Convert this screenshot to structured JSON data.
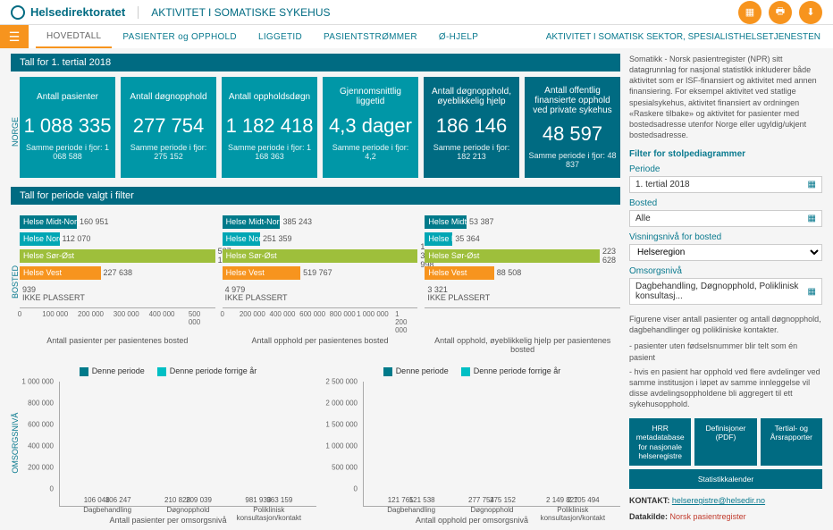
{
  "header": {
    "brand": "Helsedirektoratet",
    "title": "AKTIVITET I SOMATISKE SYKEHUS",
    "nav_right": "AKTIVITET I SOMATISK SEKTOR, SPESIALISTHELSETJENESTEN",
    "tabs": [
      "HOVEDTALL",
      "PASIENTER og OPPHOLD",
      "LIGGETID",
      "PASIENTSTRØMMER",
      "Ø-HJELP"
    ]
  },
  "section1_title": "Tall for 1. tertial 2018",
  "vlabel_norge": "NORGE",
  "kpi": [
    {
      "label": "Antall pasienter",
      "value": "1 088 335",
      "sub": "Samme periode i fjor: 1 068 588"
    },
    {
      "label": "Antall døgnopphold",
      "value": "277 754",
      "sub": "Samme periode i fjor: 275 152"
    },
    {
      "label": "Antall oppholdsdøgn",
      "value": "1 182 418",
      "sub": "Samme periode i fjor: 1 168 363"
    },
    {
      "label": "Gjennomsnittlig liggetid",
      "value": "4,3 dager",
      "sub": "Samme periode i fjor: 4,2"
    },
    {
      "label": "Antall døgnopphold, øyeblikkelig hjelp",
      "value": "186 146",
      "sub": "Samme periode i fjor: 182 213"
    },
    {
      "label": "Antall offentlig finansierte opphold ved private sykehus",
      "value": "48 597",
      "sub": "Samme periode i fjor: 48 837"
    }
  ],
  "section2_title": "Tall for periode valgt i filter",
  "vlabel_bosted": "BOSTED",
  "vlabel_oms": "OMSORGSNIVÅ",
  "legend": {
    "a": "Denne periode",
    "b": "Denne periode forrige år"
  },
  "titles": {
    "h1": "Antall pasienter per pasientenes bosted",
    "h2": "Antall opphold per pasientenes bosted",
    "h3": "Antall opphold, øyeblikkelig hjelp per pasientenes bosted",
    "v1": "Antall pasienter per omsorgsnivå",
    "v2": "Antall opphold per omsorgsnivå"
  },
  "chart_data": {
    "h_pasienter": {
      "type": "bar",
      "orientation": "h",
      "xlabel": "",
      "title": "Antall pasienter per pasientenes bosted",
      "categories": [
        "Helse Midt-Norge",
        "Helse Nord",
        "Helse Sør-Øst",
        "Helse Vest",
        "IKKE PLASSERT"
      ],
      "values": [
        160951,
        112070,
        587161,
        227638,
        939
      ],
      "xlim": [
        0,
        550000
      ],
      "ticks": [
        0,
        100000,
        200000,
        300000,
        400000,
        500000
      ],
      "colors": [
        "#007a8a",
        "#00a6b4",
        "#9ebf3b",
        "#f7941e",
        null
      ]
    },
    "h_opphold": {
      "type": "bar",
      "orientation": "h",
      "title": "Antall opphold per pasientenes bosted",
      "categories": [
        "Helse Midt-Norge",
        "Helse Nord",
        "Helse Sør-Øst",
        "Helse Vest",
        "IKKE PLASSERT"
      ],
      "values": [
        385243,
        251359,
        1387998,
        519767,
        4979
      ],
      "xlim": [
        0,
        1300000
      ],
      "ticks": [
        0,
        200000,
        400000,
        600000,
        800000,
        1000000,
        1200000
      ],
      "colors": [
        "#007a8a",
        "#00a6b4",
        "#9ebf3b",
        "#f7941e",
        null
      ]
    },
    "h_ohjelp": {
      "type": "bar",
      "orientation": "h",
      "title": "Antall opphold, øyeblikkelig hjelp per pasientenes bosted",
      "categories": [
        "Helse Midt-Norge",
        "Helse Nord",
        "Helse Sør-Øst",
        "Helse Vest",
        "IKKE PLASSERT"
      ],
      "values": [
        53387,
        35364,
        223628,
        88508,
        3321
      ],
      "xlim": [
        0,
        250000
      ],
      "ticks": [],
      "colors": [
        "#007a8a",
        "#00a6b4",
        "#9ebf3b",
        "#f7941e",
        null
      ]
    },
    "v_pasienter": {
      "type": "bar",
      "title": "Antall pasienter per omsorgsnivå",
      "categories": [
        "Dagbehandling",
        "Døgnopphold",
        "Poliklinisk konsultasjon/kontakt"
      ],
      "series": [
        {
          "name": "Denne periode",
          "values": [
            106048,
            210828,
            981933
          ],
          "color": "#007a8a"
        },
        {
          "name": "Denne periode forrige år",
          "values": [
            106247,
            209039,
            963159
          ],
          "color": "#00bfc4"
        }
      ],
      "ylim": [
        0,
        1000000
      ],
      "yticks": [
        0,
        200000,
        400000,
        600000,
        800000,
        1000000
      ]
    },
    "v_opphold": {
      "type": "bar",
      "title": "Antall opphold per omsorgsnivå",
      "categories": [
        "Dagbehandling",
        "Døgnopphold",
        "Poliklinisk konsultasjon/kontakt"
      ],
      "series": [
        {
          "name": "Denne periode",
          "values": [
            121765,
            277754,
            2149827
          ],
          "color": "#007a8a"
        },
        {
          "name": "Denne periode forrige år",
          "values": [
            121538,
            275152,
            2105494
          ],
          "color": "#00bfc4"
        }
      ],
      "ylim": [
        0,
        2500000
      ],
      "yticks": [
        0,
        500000,
        1000000,
        1500000,
        2000000,
        2500000
      ]
    }
  },
  "side": {
    "intro": "Somatikk - Norsk pasientregister (NPR) sitt datagrunnlag for nasjonal statistikk inkluderer både aktivitet som er ISF-finansiert og aktivitet med annen finansiering. For eksempel aktivitet ved statlige spesialsykehus, aktivitet finansiert av ordningen «Raskere tilbake» og aktivitet for pasienter med bostedsadresse utenfor Norge eller ugyldig/ukjent bostedsadresse.",
    "filter_head": "Filter for stolpediagrammer",
    "periode_label": "Periode",
    "periode_value": "1. tertial 2018",
    "bosted_label": "Bosted",
    "bosted_value": "Alle",
    "visning_label": "Visningsnivå for bosted",
    "visning_value": "Helseregion",
    "oms_label": "Omsorgsnivå",
    "oms_value": "Dagbehandling, Døgnopphold, Poliklinisk konsultasj...",
    "desc": "Figurene viser antall pasienter og antall døgnopphold, dagbehandlinger og polikliniske kontakter.",
    "note1": "- pasienter uten fødselsnummer blir telt som én pasient",
    "note2": "- hvis en pasient har opphold ved flere avdelinger ved samme institusjon i løpet av samme innleggelse vil disse avdelingsoppholdene bli aggregert til ett sykehusopphold.",
    "btns": [
      "HRR metadatabase for nasjonale helseregistre",
      "Definisjoner (PDF)",
      "Tertial- og Årsrapporter",
      "Statistikkalender"
    ],
    "kontakt_label": "KONTAKT:",
    "kontakt_link": "helseregistre@helsedir.no",
    "datakilde_label": "Datakilde:",
    "datakilde_value": "Norsk pasientregister"
  }
}
